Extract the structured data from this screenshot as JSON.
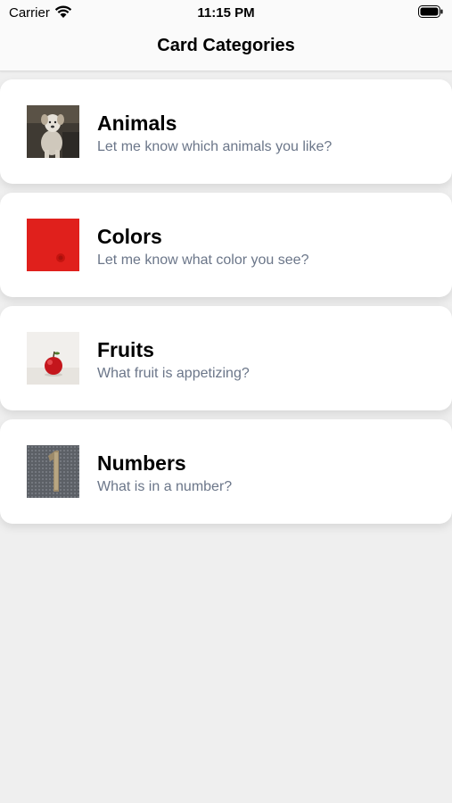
{
  "status_bar": {
    "carrier": "Carrier",
    "time": "11:15 PM",
    "wifi_icon": "wifi-icon",
    "battery_icon": "battery-icon"
  },
  "nav": {
    "title": "Card Categories"
  },
  "categories": [
    {
      "title": "Animals",
      "subtitle": "Let me know which animals you like?",
      "image": "dog-photo"
    },
    {
      "title": "Colors",
      "subtitle": "Let me know what color you see?",
      "image": "red-photo"
    },
    {
      "title": "Fruits",
      "subtitle": "What fruit is appetizing?",
      "image": "apple-photo"
    },
    {
      "title": "Numbers",
      "subtitle": "What is in a number?",
      "image": "number-one-photo"
    }
  ],
  "colors": {
    "background": "#efefef",
    "card": "#ffffff",
    "subtitle": "#6b7689"
  }
}
